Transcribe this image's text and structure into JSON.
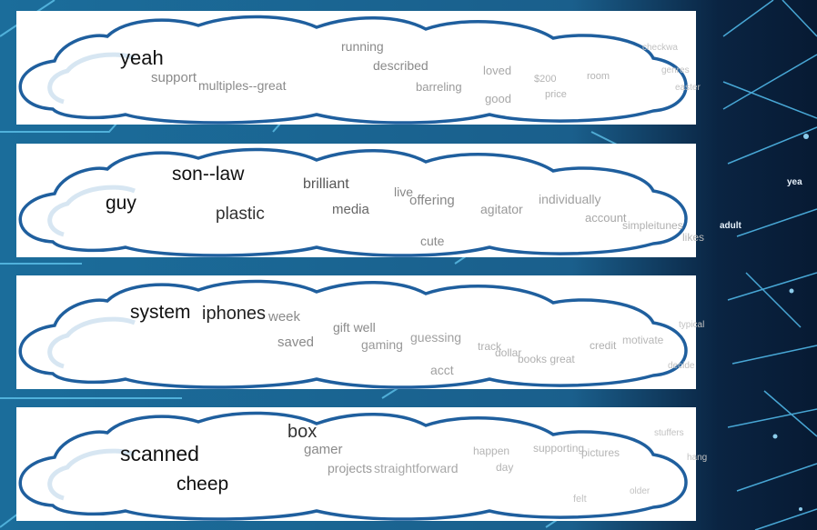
{
  "colors": {
    "background": "#0d3f66",
    "circuit": "#5fc4ee",
    "cloud_outline": "#1f5f9e",
    "word_dark": "#111111",
    "word_mid": "#8a8a8a",
    "word_light": "#bcbcbc"
  },
  "clouds": [
    {
      "words": [
        "yeah",
        "support",
        "multiples--great",
        "running",
        "described",
        "barreling",
        "loved",
        "good",
        "$200",
        "price",
        "room",
        "checkwa",
        "genres",
        "easter"
      ]
    },
    {
      "words": [
        "son--law",
        "guy",
        "plastic",
        "brilliant",
        "media",
        "live",
        "offering",
        "agitator",
        "individually",
        "account",
        "simpleitunes",
        "likes",
        "cute"
      ]
    },
    {
      "words": [
        "system",
        "iphones",
        "week",
        "saved",
        "gift well",
        "gaming",
        "guessing",
        "track",
        "dollar",
        "books great",
        "credit",
        "motivate",
        "typical",
        "decide",
        "acct"
      ]
    },
    {
      "words": [
        "box",
        "scanned",
        "cheep",
        "gamer",
        "projects",
        "straightforward",
        "happen",
        "day",
        "supporting",
        "pictures",
        "stuffers",
        "hang",
        "felt",
        "older"
      ]
    }
  ],
  "side_words": [
    "yea",
    "adult"
  ]
}
